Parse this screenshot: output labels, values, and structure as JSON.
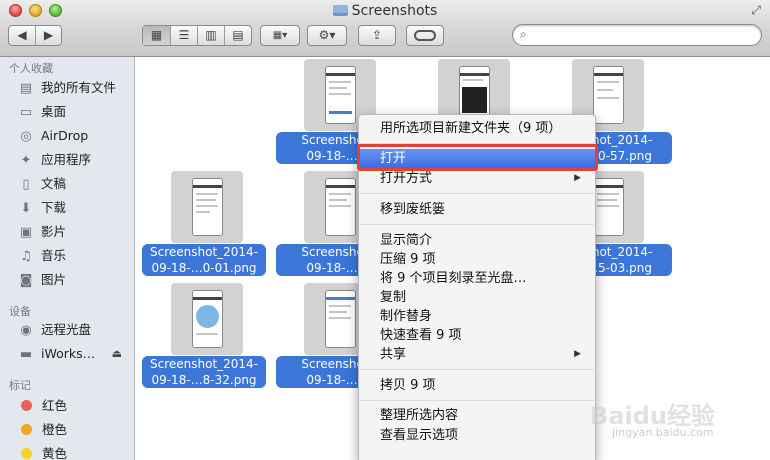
{
  "window": {
    "title": "Screenshots"
  },
  "toolbar": {
    "back_icon": "chevron-left-icon",
    "forward_icon": "chevron-right-icon",
    "view_modes": [
      "icon-view-icon",
      "list-view-icon",
      "column-view-icon",
      "coverflow-view-icon"
    ],
    "active_view": "icon-view-icon",
    "arrange_icon": "arrange-icon",
    "action_icon": "gear-icon",
    "share_icon": "share-icon",
    "tags_icon": "tag-icon",
    "search": {
      "value": "",
      "placeholder": ""
    }
  },
  "sidebar": {
    "favorites_header": "个人收藏",
    "favorites": [
      {
        "label": "我的所有文件",
        "icon": "all-files-icon"
      },
      {
        "label": "桌面",
        "icon": "desktop-icon"
      },
      {
        "label": "AirDrop",
        "icon": "airdrop-icon"
      },
      {
        "label": "应用程序",
        "icon": "applications-icon"
      },
      {
        "label": "文稿",
        "icon": "documents-icon"
      },
      {
        "label": "下载",
        "icon": "downloads-icon"
      },
      {
        "label": "影片",
        "icon": "movies-icon"
      },
      {
        "label": "音乐",
        "icon": "music-icon"
      },
      {
        "label": "图片",
        "icon": "pictures-icon"
      }
    ],
    "devices_header": "设备",
    "devices": [
      {
        "label": "远程光盘",
        "icon": "remote-disc-icon"
      },
      {
        "label": "iWorks…",
        "icon": "disk-icon",
        "eject": "eject-icon"
      }
    ],
    "tags_header": "标记",
    "tags": [
      {
        "label": "红色",
        "color": "#f0605a"
      },
      {
        "label": "橙色",
        "color": "#f5a623"
      },
      {
        "label": "黄色",
        "color": "#f5d328"
      }
    ]
  },
  "files": [
    {
      "line1": "Screenshot_",
      "line2": "09-18-…1-"
    },
    {
      "line1": "",
      "line2": ""
    },
    {
      "line1": "shot_2014-",
      "line2": "…0-57.png"
    },
    {
      "line1": "Screenshot_2014-",
      "line2": "09-18-…0-01.png"
    },
    {
      "line1": "Screenshot_",
      "line2": "09-18-…9-"
    },
    {
      "line1": "",
      "line2": ""
    },
    {
      "line1": "shot_2014-",
      "line2": "…5-03.png"
    },
    {
      "line1": "Screenshot_2014-",
      "line2": "09-18-…8-32.png"
    },
    {
      "line1": "Screenshot_",
      "line2": "09-18-…8-"
    }
  ],
  "context_menu": {
    "items": [
      {
        "label": "用所选项目新建文件夹（9 项）"
      },
      {
        "label": "打开",
        "highlighted": true
      },
      {
        "label": "打开方式",
        "submenu_icon": "chevron-right-icon"
      },
      {
        "label": "移到废纸篓"
      },
      {
        "label": "显示简介"
      },
      {
        "label": "压缩 9 项"
      },
      {
        "label": "将 9 个项目刻录至光盘…"
      },
      {
        "label": "复制"
      },
      {
        "label": "制作替身"
      },
      {
        "label": "快速查看 9 项"
      },
      {
        "label": "共享",
        "submenu_icon": "chevron-right-icon"
      },
      {
        "label": "拷贝 9 项"
      },
      {
        "label": "整理所选内容"
      },
      {
        "label": "查看显示选项"
      }
    ]
  },
  "watermark": {
    "brand": "Baidu经验",
    "url": "jingyan.baidu.com"
  },
  "colors": {
    "selection": "#3c76d9",
    "menu_highlight": "#3b6ce6",
    "annotation_ring": "#e24236",
    "sidebar_bg": "#e3e8ee"
  }
}
